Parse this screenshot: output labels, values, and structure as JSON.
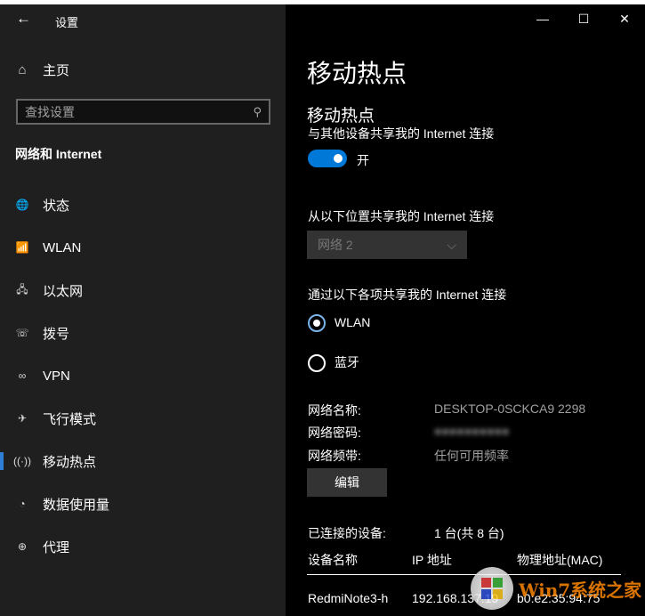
{
  "window": {
    "title": "设置",
    "minimize": "—",
    "maximize": "☐",
    "close": "✕"
  },
  "sidebar": {
    "home": "主页",
    "search_placeholder": "查找设置",
    "section": "网络和 Internet",
    "items": [
      {
        "icon": "globe-icon",
        "glyph": "🌐",
        "label": "状态"
      },
      {
        "icon": "wifi-icon",
        "glyph": "📶",
        "label": "WLAN"
      },
      {
        "icon": "ethernet-icon",
        "glyph": "🖧",
        "label": "以太网"
      },
      {
        "icon": "dialup-icon",
        "glyph": "☏",
        "label": "拨号"
      },
      {
        "icon": "vpn-icon",
        "glyph": "∞",
        "label": "VPN"
      },
      {
        "icon": "airplane-icon",
        "glyph": "✈",
        "label": "飞行模式"
      },
      {
        "icon": "hotspot-icon",
        "glyph": "((·))",
        "label": "移动热点",
        "selected": true
      },
      {
        "icon": "data-usage-icon",
        "glyph": "◔",
        "label": "数据使用量"
      },
      {
        "icon": "proxy-icon",
        "glyph": "⊕",
        "label": "代理"
      }
    ]
  },
  "main": {
    "title": "移动热点",
    "section": "移动热点",
    "share_label": "与其他设备共享我的 Internet 连接",
    "toggle_state": "开",
    "toggle_on": true,
    "from_label": "从以下位置共享我的 Internet 连接",
    "from_value": "网络 2",
    "via_label": "通过以下各项共享我的 Internet 连接",
    "via_options": [
      {
        "label": "WLAN",
        "selected": true
      },
      {
        "label": "蓝牙",
        "selected": false
      }
    ],
    "info": [
      {
        "k": "网络名称:",
        "v": "DESKTOP-0SCKCA9 2298"
      },
      {
        "k": "网络密码:",
        "v": "●●●●●●●●●●"
      },
      {
        "k": "网络频带:",
        "v": "任何可用频率"
      }
    ],
    "edit": "编辑",
    "connected_label": "已连接的设备:",
    "connected_value": "1 台(共 8 台)",
    "columns": [
      "设备名称",
      "IP 地址",
      "物理地址(MAC)"
    ],
    "devices": [
      [
        "RedmiNote3-h",
        "192.168.137.19",
        "b0:e2:35:94:75"
      ]
    ]
  },
  "watermark": "Win7系统之家",
  "accent": "#0078d7"
}
